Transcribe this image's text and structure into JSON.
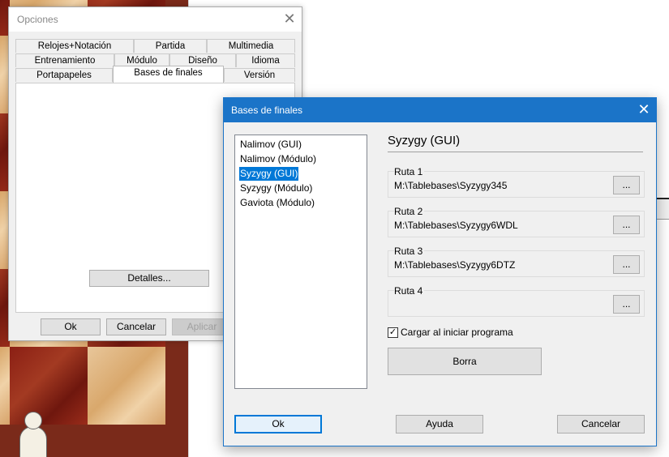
{
  "opciones": {
    "title": "Opciones",
    "tabs": [
      {
        "label": "Relojes+Notación"
      },
      {
        "label": "Partida"
      },
      {
        "label": "Multimedia"
      },
      {
        "label": "Entrenamiento"
      },
      {
        "label": "Módulo"
      },
      {
        "label": "Diseño"
      },
      {
        "label": "Idioma"
      },
      {
        "label": "Portapapeles"
      },
      {
        "label": "Bases de finales"
      },
      {
        "label": "Versión"
      }
    ],
    "details_label": "Detalles...",
    "ok_label": "Ok",
    "cancel_label": "Cancelar",
    "apply_label": "Aplicar"
  },
  "dialog": {
    "title": "Bases de finales",
    "list": [
      {
        "label": "Nalimov (GUI)"
      },
      {
        "label": "Nalimov (Módulo)"
      },
      {
        "label": "Syzygy (GUI)"
      },
      {
        "label": "Syzygy (Módulo)"
      },
      {
        "label": "Gaviota (Módulo)"
      }
    ],
    "selected_index": 2,
    "heading": "Syzygy (GUI)",
    "paths": [
      {
        "label": "Ruta 1",
        "value": "M:\\Tablebases\\Syzygy345"
      },
      {
        "label": "Ruta 2",
        "value": "M:\\Tablebases\\Syzygy6WDL"
      },
      {
        "label": "Ruta 3",
        "value": "M:\\Tablebases\\Syzygy6DTZ"
      },
      {
        "label": "Ruta 4",
        "value": ""
      }
    ],
    "browse_label": "...",
    "load_checkbox_label": "Cargar al iniciar programa",
    "load_checked": true,
    "clear_label": "Borra",
    "ok_label": "Ok",
    "help_label": "Ayuda",
    "cancel_label": "Cancelar"
  },
  "colors": {
    "accent": "#1b74c8",
    "selection": "#0078d7"
  }
}
